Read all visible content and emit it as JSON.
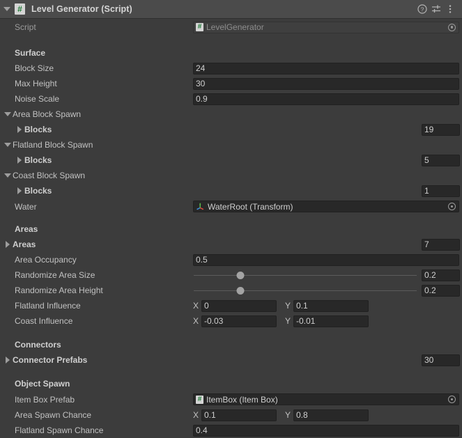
{
  "header": {
    "title": "Level Generator (Script)",
    "script_icon": "csharp-script-icon",
    "foldout": "expanded",
    "help_icon": "help-icon",
    "preset_icon": "preset-icon",
    "menu_icon": "more-options-icon"
  },
  "script_row": {
    "label": "Script",
    "value": "LevelGenerator",
    "icon": "csharp-script-icon",
    "picker": "object-picker-icon"
  },
  "sections": {
    "surface": "Surface",
    "areas": "Areas",
    "connectors": "Connectors",
    "object_spawn": "Object Spawn"
  },
  "fields": {
    "block_size": {
      "label": "Block Size",
      "value": "24"
    },
    "max_height": {
      "label": "Max Height",
      "value": "30"
    },
    "noise_scale": {
      "label": "Noise Scale",
      "value": "0.9"
    },
    "area_block_spawn": {
      "label": "Area Block Spawn"
    },
    "area_blocks": {
      "label": "Blocks",
      "value": "19"
    },
    "flatland_block_spawn": {
      "label": "Flatland Block Spawn"
    },
    "flatland_blocks": {
      "label": "Blocks",
      "value": "5"
    },
    "coast_block_spawn": {
      "label": "Coast Block Spawn"
    },
    "coast_blocks": {
      "label": "Blocks",
      "value": "1"
    },
    "water": {
      "label": "Water",
      "value": "WaterRoot (Transform)",
      "icon": "transform-icon",
      "picker": "object-picker-icon"
    },
    "areas_list": {
      "label": "Areas",
      "value": "7"
    },
    "area_occupancy": {
      "label": "Area Occupancy",
      "value": "0.5"
    },
    "randomize_area_size": {
      "label": "Randomize Area Size",
      "value": "0.2",
      "slider_pct": 21
    },
    "randomize_area_height": {
      "label": "Randomize Area Height",
      "value": "0.2",
      "slider_pct": 21
    },
    "flatland_influence": {
      "label": "Flatland Influence",
      "x_label": "X",
      "x": "0",
      "y_label": "Y",
      "y": "0.1"
    },
    "coast_influence": {
      "label": "Coast Influence",
      "x_label": "X",
      "x": "-0.03",
      "y_label": "Y",
      "y": "-0.01"
    },
    "connector_prefabs": {
      "label": "Connector Prefabs",
      "value": "30"
    },
    "item_box_prefab": {
      "label": "Item Box Prefab",
      "value": "ItemBox (Item Box)",
      "icon": "prefab-script-icon",
      "picker": "object-picker-icon"
    },
    "area_spawn_chance": {
      "label": "Area Spawn Chance",
      "x_label": "X",
      "x": "0.1",
      "y_label": "Y",
      "y": "0.8"
    },
    "flatland_spawn_chance": {
      "label": "Flatland Spawn Chance",
      "value": "0.4"
    }
  },
  "colors": {
    "background": "#3c3c3c",
    "header": "#4b4b4b",
    "field": "#282828",
    "text": "#c2c2c2",
    "script_green": "#1d7a34"
  }
}
